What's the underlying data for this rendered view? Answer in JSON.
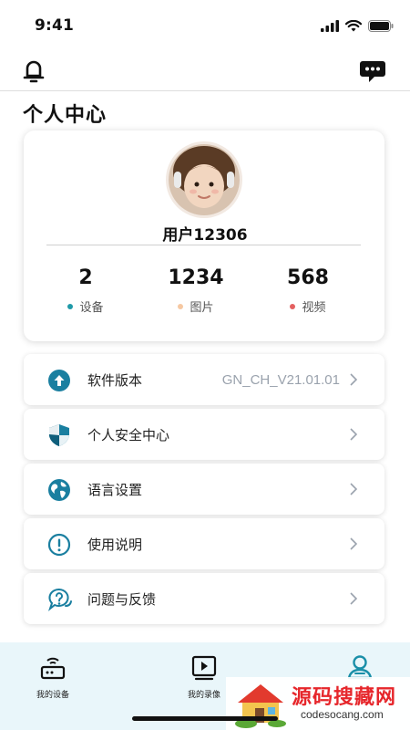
{
  "status_bar": {
    "time": "9:41"
  },
  "header": {
    "title": "个人中心"
  },
  "profile": {
    "username": "用户12306",
    "stats": [
      {
        "value": "2",
        "label": "设备",
        "dot_color": "#1f9aa8"
      },
      {
        "value": "1234",
        "label": "图片",
        "dot_color": "#f6c8a2"
      },
      {
        "value": "568",
        "label": "视频",
        "dot_color": "#e46060"
      }
    ]
  },
  "menu": {
    "items": [
      {
        "label": "软件版本",
        "value": "GN_CH_V21.01.01",
        "icon": "upload-circle-icon"
      },
      {
        "label": "个人安全中心",
        "value": "",
        "icon": "shield-icon"
      },
      {
        "label": "语言设置",
        "value": "",
        "icon": "globe-icon"
      },
      {
        "label": "使用说明",
        "value": "",
        "icon": "info-circle-icon"
      },
      {
        "label": "问题与反馈",
        "value": "",
        "icon": "help-bubble-icon"
      }
    ]
  },
  "bottom_nav": {
    "items": [
      {
        "label": "我的设备",
        "icon": "router-icon"
      },
      {
        "label": "我的录像",
        "icon": "video-icon"
      },
      {
        "label": "",
        "icon": "user-icon",
        "active": true
      }
    ]
  },
  "watermark": {
    "text": "源码搜藏网",
    "url": "codesocang.com"
  },
  "colors": {
    "accent": "#1a8fa8",
    "nav_bg": "#e9f6fa",
    "muted": "#9aa2ad"
  }
}
